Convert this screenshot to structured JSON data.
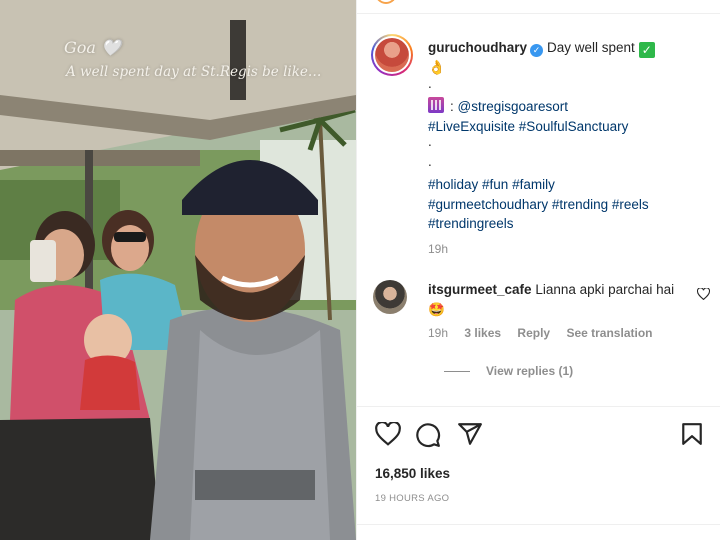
{
  "media": {
    "overlay_title": "Goa 🤍",
    "overlay_subtitle": "A well spent day at St.Regis be like…"
  },
  "post": {
    "author": "guruchoudhary",
    "caption_text": "Day well spent",
    "caption_dot1": ".",
    "mention": "@stregisgoaresort",
    "tags_line1": "#LiveExquisite #SoulfulSanctuary",
    "caption_dot2": ".",
    "caption_dot3": ".",
    "tags_line2": "#holiday #fun #family",
    "tags_line3": "#gurmeetchoudhary #trending #reels",
    "tags_line4": "#trendingreels",
    "time_ago": "19h",
    "likes": "16,850 likes",
    "posted": "19 HOURS AGO"
  },
  "comment": {
    "author": "itsgurmeet_cafe",
    "text": "Lianna apki parchai hai",
    "emoji": "🤩",
    "time": "19h",
    "likes": "3 likes",
    "reply": "Reply",
    "see_translation": "See translation",
    "view_replies": "View replies (1)"
  },
  "colors": {
    "link": "#00376b",
    "muted": "#8e8e8e",
    "verified": "#3897f0",
    "check": "#2eb84a"
  },
  "icons": [
    "heart-icon",
    "comment-icon",
    "share-icon",
    "bookmark-icon",
    "verified-badge-icon",
    "check-mark-icon"
  ]
}
